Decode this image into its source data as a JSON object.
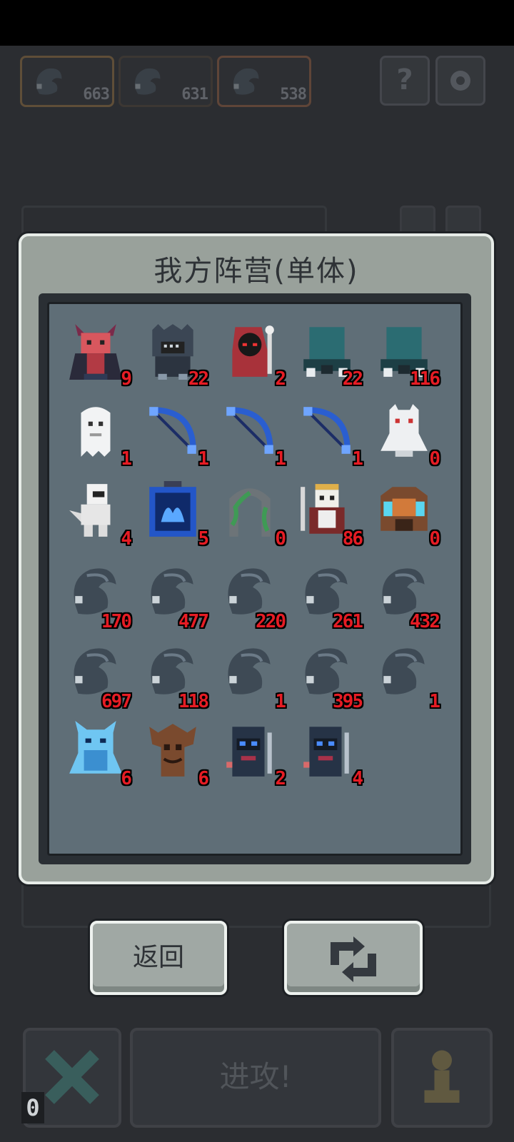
{
  "resources": [
    {
      "icon": "shadow-ghost-icon",
      "count": "663",
      "border": "#8a6a3e"
    },
    {
      "icon": "shadow-ghost-icon",
      "count": "631",
      "border": "#5b5f65"
    },
    {
      "icon": "shadow-ghost-icon",
      "count": "538",
      "border": "#8a5a3e"
    }
  ],
  "hud": {
    "help_label": "?",
    "settings_icon": "gear-icon"
  },
  "modal": {
    "title": "我方阵营(单体)",
    "units": [
      {
        "icon": "red-demon-icon",
        "count": "9"
      },
      {
        "icon": "dark-golem-icon",
        "count": "22"
      },
      {
        "icon": "red-mage-icon",
        "count": "2"
      },
      {
        "icon": "teal-hood-icon",
        "count": "22"
      },
      {
        "icon": "teal-hood-icon",
        "count": "116"
      },
      {
        "icon": "white-ghost-icon",
        "count": "1"
      },
      {
        "icon": "blue-bow-icon",
        "count": "1"
      },
      {
        "icon": "blue-bow-icon",
        "count": "1"
      },
      {
        "icon": "blue-bow-icon",
        "count": "1"
      },
      {
        "icon": "white-yeti-icon",
        "count": "0"
      },
      {
        "icon": "white-knight-icon",
        "count": "4"
      },
      {
        "icon": "blue-cage-icon",
        "count": "5"
      },
      {
        "icon": "vine-arch-icon",
        "count": "0"
      },
      {
        "icon": "skeleton-king-icon",
        "count": "86"
      },
      {
        "icon": "beast-rider-icon",
        "count": "0"
      },
      {
        "icon": "shadow-ghost-icon",
        "count": "170"
      },
      {
        "icon": "shadow-ghost-icon",
        "count": "477"
      },
      {
        "icon": "shadow-ghost-icon",
        "count": "220"
      },
      {
        "icon": "shadow-ghost-icon",
        "count": "261"
      },
      {
        "icon": "shadow-ghost-icon",
        "count": "432"
      },
      {
        "icon": "shadow-ghost-icon",
        "count": "697"
      },
      {
        "icon": "shadow-ghost-icon",
        "count": "118"
      },
      {
        "icon": "shadow-ghost-icon",
        "count": "1"
      },
      {
        "icon": "shadow-ghost-icon",
        "count": "395"
      },
      {
        "icon": "shadow-ghost-icon",
        "count": "1"
      },
      {
        "icon": "ice-demon-icon",
        "count": "6"
      },
      {
        "icon": "tree-ent-icon",
        "count": "6"
      },
      {
        "icon": "dark-reaper-icon",
        "count": "2"
      },
      {
        "icon": "dark-reaper-icon",
        "count": "4"
      }
    ]
  },
  "buttons": {
    "back_label": "返回",
    "swap_icon": "swap-arrows-icon",
    "attack_label": "进攻!",
    "cancel_icon": "x-icon",
    "pawn_icon": "pawn-icon",
    "zero_badge": "0"
  },
  "colors": {
    "count_red": "#e61c24",
    "panel": "#99a19b",
    "grid_bg": "#5f6e77"
  }
}
